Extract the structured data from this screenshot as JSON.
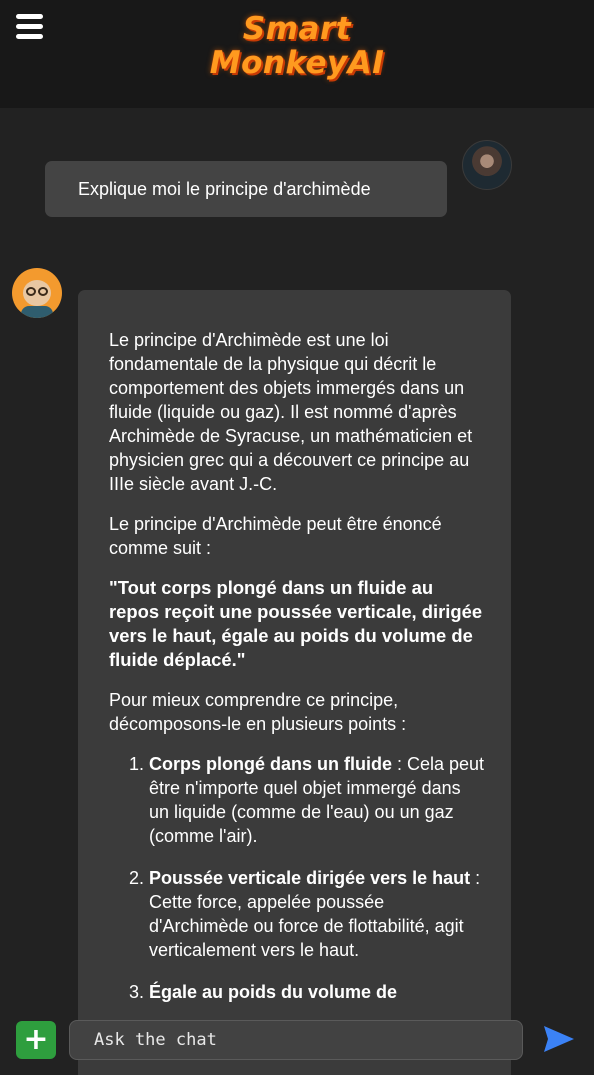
{
  "header": {
    "menu_icon": "hamburger-menu-icon",
    "logo_line1": "Smart",
    "logo_line2": "MonkeyAI"
  },
  "colors": {
    "logo": "#ff9a1f",
    "add_button": "#2e9e3e",
    "send_icon": "#3b82f6"
  },
  "conversation": {
    "user_message": "Explique moi le principe d'archimède",
    "bot_reply": {
      "p1": "Le principe d'Archimède est une loi fondamentale de la physique qui décrit le comportement des objets immergés dans un fluide (liquide ou gaz). Il est nommé d'après Archimède de Syracuse, un mathématicien et physicien grec qui a découvert ce principe au IIIe siècle avant J.-C.",
      "p2": "Le principe d'Archimède peut être énoncé comme suit :",
      "quote": "\"Tout corps plongé dans un fluide au repos reçoit une poussée verticale, dirigée vers le haut, égale au poids du volume de fluide déplacé.\"",
      "p3": "Pour mieux comprendre ce principe, décomposons-le en plusieurs points :",
      "points": [
        {
          "title": "Corps plongé dans un fluide",
          "text": " : Cela peut être n'importe quel objet immergé dans un liquide (comme de l'eau) ou un gaz (comme l'air)."
        },
        {
          "title": "Poussée verticale dirigée vers le haut",
          "text": " : Cette force, appelée poussée d'Archimède ou force de flottabilité, agit verticalement vers le haut."
        },
        {
          "title": "Égale au poids du volume de",
          "text": ""
        }
      ]
    }
  },
  "composer": {
    "placeholder": "Ask the chat",
    "add_label": "+",
    "send_icon": "send-arrow-icon"
  }
}
